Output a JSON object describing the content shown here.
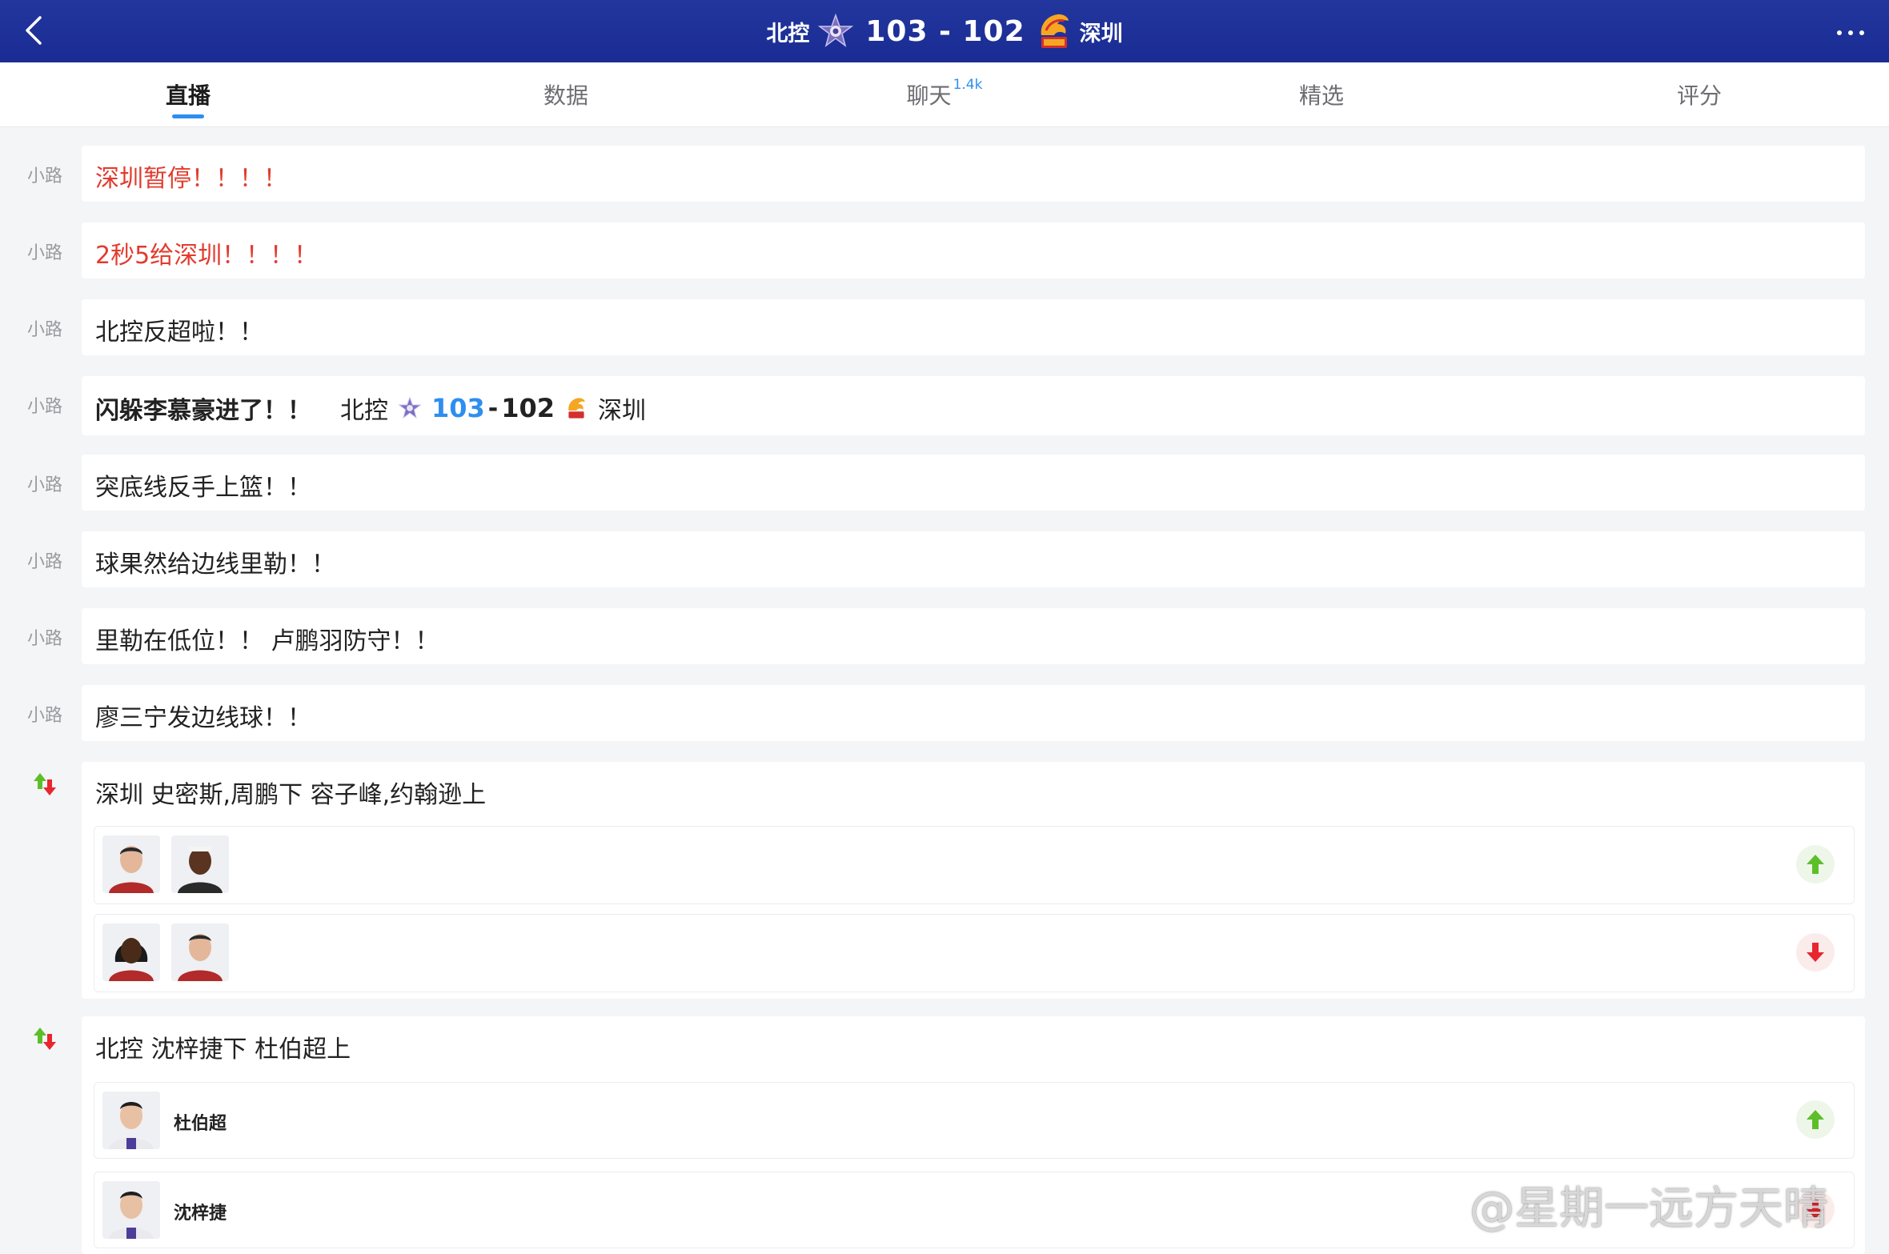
{
  "header": {
    "home_team": "北控",
    "away_team": "深圳",
    "score": "103 - 102",
    "back_icon": "chevron-left-icon",
    "more_icon": "more-dots-icon",
    "bg_color": "#1c2f9a"
  },
  "tabs": [
    {
      "label": "直播",
      "active": true
    },
    {
      "label": "数据",
      "active": false
    },
    {
      "label": "聊天",
      "badge": "1.4k",
      "active": false
    },
    {
      "label": "精选",
      "active": false
    },
    {
      "label": "评分",
      "active": false
    }
  ],
  "feed": [
    {
      "speaker": "小路",
      "text": "深圳暂停！！！！",
      "style": "red"
    },
    {
      "speaker": "小路",
      "text": "2秒5给深圳！！！！",
      "style": "red"
    },
    {
      "speaker": "小路",
      "text": "北控反超啦！！",
      "style": "normal"
    },
    {
      "speaker": "小路",
      "text": "闪躲李慕豪进了！！",
      "style": "bold",
      "score": {
        "home": "北控",
        "home_score": "103",
        "dash": "-",
        "away_score": "102",
        "away": "深圳"
      }
    },
    {
      "speaker": "小路",
      "text": "突底线反手上篮！！",
      "style": "normal"
    },
    {
      "speaker": "小路",
      "text": "球果然给边线里勒！！",
      "style": "normal"
    },
    {
      "speaker": "小路",
      "text": "里勒在低位！！ 卢鹏羽防守！！",
      "style": "normal"
    },
    {
      "speaker": "小路",
      "text": "廖三宁发边线球！！",
      "style": "normal"
    }
  ],
  "substitutions": [
    {
      "text": "深圳 史密斯,周鹏下 容子峰,约翰逊上"
    },
    {
      "text": "北控 沈梓捷下 杜伯超上",
      "in_player": "杜伯超",
      "out_player": "沈梓捷"
    }
  ],
  "watermark": "@星期一远方天晴",
  "colors": {
    "accent": "#2e8ef0",
    "alert": "#e23b2e",
    "up": "#5cbf2a",
    "down": "#e8262f"
  }
}
